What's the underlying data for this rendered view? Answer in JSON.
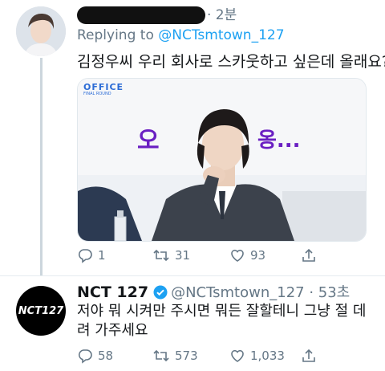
{
  "tweet1": {
    "display_name_suffix": "· 2분",
    "replying_prefix": "Replying to",
    "replying_handle": "@NCTsmtown_127",
    "text": "김정우씨 우리 회사로 스카웃하고 싶은데 올래요?",
    "media": {
      "badge_line1": "OFFICE",
      "badge_line2": "FINAL ROUND",
      "caption_left": "오",
      "caption_right": "옹..."
    },
    "actions": {
      "replies": "1",
      "retweets": "31",
      "likes": "93"
    }
  },
  "tweet2": {
    "name": "NCT 127",
    "handle_time": "@NCTsmtown_127 · 53초",
    "avatar_logo": "NCT127",
    "text": "저야 뭐 시켜만 주시면 뭐든 잘할테니 그냥 절 데려 가주세요",
    "actions": {
      "replies": "58",
      "retweets": "573",
      "likes": "1,033"
    }
  },
  "colors": {
    "link": "#1da1f2",
    "muted": "#657786",
    "caption": "#6a1fc2"
  }
}
